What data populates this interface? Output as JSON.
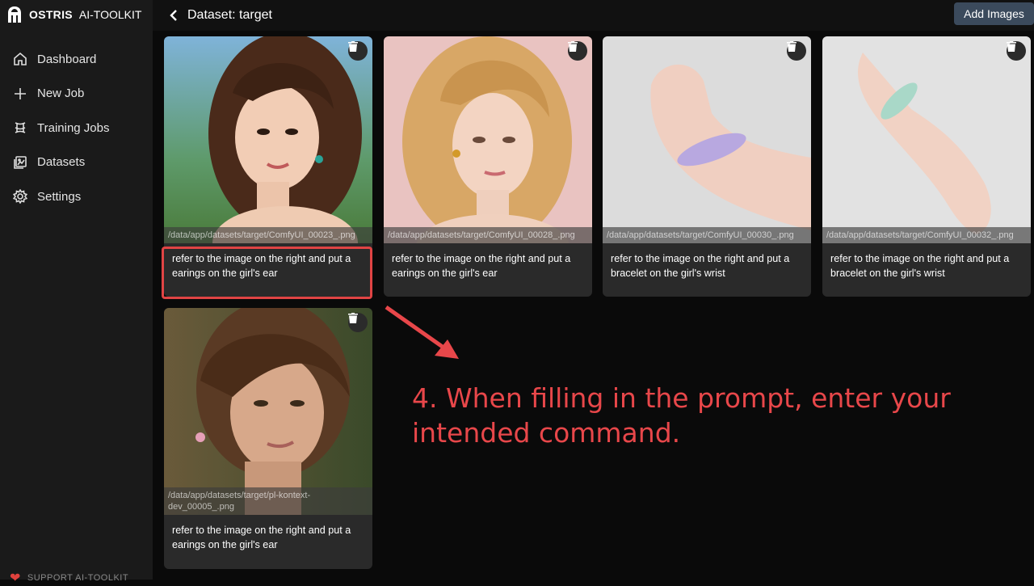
{
  "brand": {
    "name": "OSTRIS",
    "sub": "AI-TOOLKIT"
  },
  "nav": [
    {
      "label": "Dashboard",
      "icon": "home-icon"
    },
    {
      "label": "New Job",
      "icon": "plus-icon"
    },
    {
      "label": "Training Jobs",
      "icon": "training-icon"
    },
    {
      "label": "Datasets",
      "icon": "images-icon"
    },
    {
      "label": "Settings",
      "icon": "gear-icon"
    }
  ],
  "support_label": "SUPPORT AI-TOOLKIT",
  "header": {
    "title": "Dataset: target",
    "add_images": "Add Images"
  },
  "cards": [
    {
      "path": "/data/app/datasets/target/ComfyUI_00023_.png",
      "caption": "refer to the image on the right and put a earings on the girl's ear"
    },
    {
      "path": "/data/app/datasets/target/ComfyUI_00028_.png",
      "caption": "refer to the image on the right and put a earings on the girl's ear"
    },
    {
      "path": "/data/app/datasets/target/ComfyUI_00030_.png",
      "caption": "refer to the image on the right and put a bracelet on the girl's wrist"
    },
    {
      "path": "/data/app/datasets/target/ComfyUI_00032_.png",
      "caption": "refer to the image on the right and put a bracelet on the girl's wrist"
    },
    {
      "path": "/data/app/datasets/target/pl-kontext-dev_00005_.png",
      "caption": "refer to the image on the right and put a earings on the girl's ear"
    }
  ],
  "annotation": "4. When filling in the prompt, enter your intended command.",
  "colors": {
    "accent": "#e8474a",
    "button": "#3b4a5c",
    "card": "#2a2a2a"
  }
}
